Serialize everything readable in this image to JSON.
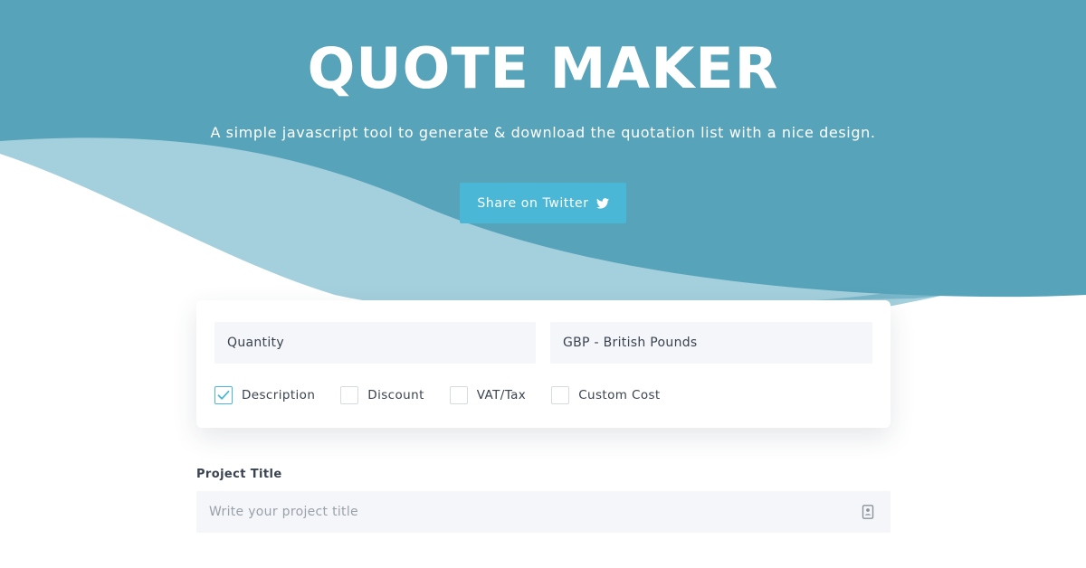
{
  "hero": {
    "title": "QUOTE MAKER",
    "subtitle": "A simple javascript tool to generate & download the quotation list with a nice design.",
    "share_button_label": "Share on Twitter"
  },
  "settings": {
    "quantity_select_value": "Quantity",
    "currency_select_value": "GBP - British Pounds",
    "options": [
      {
        "label": "Description",
        "checked": true
      },
      {
        "label": "Discount",
        "checked": false
      },
      {
        "label": "VAT/Tax",
        "checked": false
      },
      {
        "label": "Custom Cost",
        "checked": false
      }
    ]
  },
  "project": {
    "label": "Project Title",
    "placeholder": "Write your project title",
    "value": ""
  },
  "icons": {
    "share": "twitter-icon",
    "checkmark": "checkmark-icon",
    "input": "contact-book-icon"
  },
  "colors": {
    "hero_dark": "#57a3ba",
    "hero_light": "#a4cfdc",
    "accent": "#4ab7d7",
    "input_bg": "#f4f6f9",
    "text": "#3a4350",
    "placeholder": "#9aa1aa"
  }
}
